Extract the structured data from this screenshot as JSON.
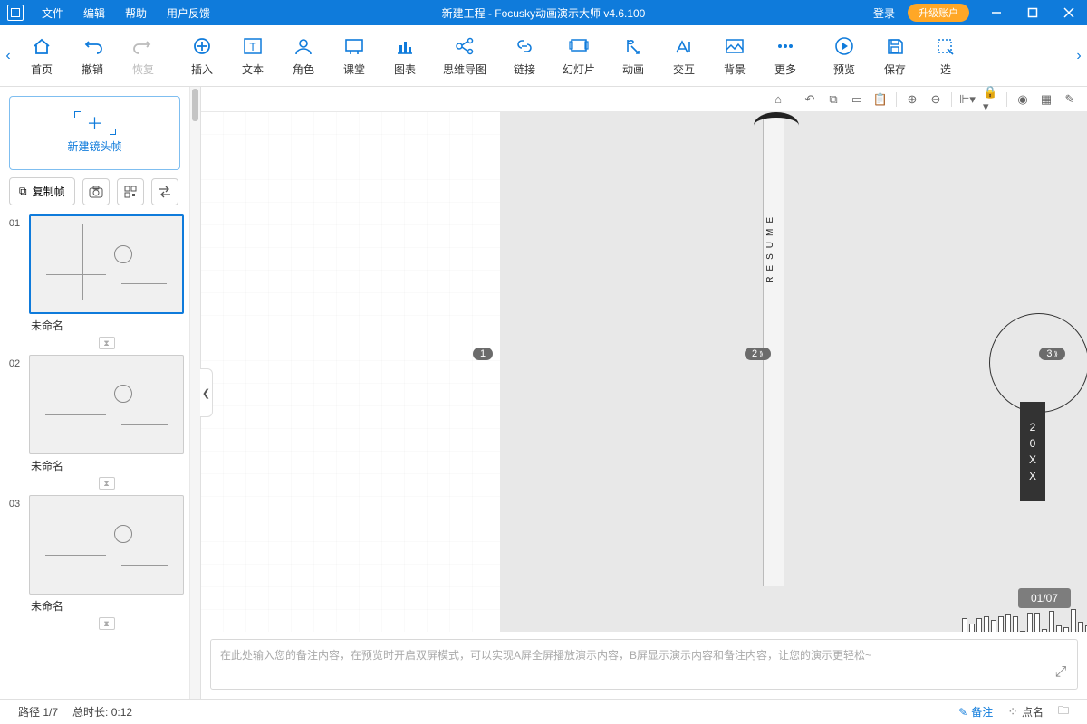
{
  "titlebar": {
    "menus": [
      "文件",
      "编辑",
      "帮助",
      "用户反馈"
    ],
    "title": "新建工程 - Focusky动画演示大师  v4.6.100",
    "login": "登录",
    "upgrade": "升级账户"
  },
  "toolbar": {
    "groups": [
      [
        {
          "id": "home",
          "label": "首页",
          "icon": "home"
        },
        {
          "id": "undo",
          "label": "撤销",
          "icon": "undo"
        },
        {
          "id": "redo",
          "label": "恢复",
          "icon": "redo",
          "disabled": true
        }
      ],
      [
        {
          "id": "insert",
          "label": "插入",
          "icon": "insert"
        },
        {
          "id": "text",
          "label": "文本",
          "icon": "text"
        },
        {
          "id": "role",
          "label": "角色",
          "icon": "role"
        },
        {
          "id": "class",
          "label": "课堂",
          "icon": "class"
        },
        {
          "id": "chart",
          "label": "图表",
          "icon": "chart"
        },
        {
          "id": "mindmap",
          "label": "思维导图",
          "icon": "mindmap"
        },
        {
          "id": "link",
          "label": "链接",
          "icon": "link"
        },
        {
          "id": "slide",
          "label": "幻灯片",
          "icon": "slide"
        },
        {
          "id": "anim",
          "label": "动画",
          "icon": "anim"
        },
        {
          "id": "interact",
          "label": "交互",
          "icon": "interact"
        },
        {
          "id": "bg",
          "label": "背景",
          "icon": "bg"
        },
        {
          "id": "more",
          "label": "更多",
          "icon": "more"
        }
      ],
      [
        {
          "id": "preview",
          "label": "预览",
          "icon": "preview"
        },
        {
          "id": "save",
          "label": "保存",
          "icon": "save"
        },
        {
          "id": "select",
          "label": "选",
          "icon": "select"
        }
      ]
    ]
  },
  "leftPanel": {
    "newFrame": "新建镜头帧",
    "copyFrame": "复制帧",
    "slides": [
      {
        "num": "01",
        "title": "未命名"
      },
      {
        "num": "02",
        "title": "未命名"
      },
      {
        "num": "03",
        "title": "未命名"
      }
    ]
  },
  "canvas": {
    "navChips": [
      "1",
      "2",
      "3"
    ],
    "pageIndicator": "01/07",
    "yearBox": [
      "2",
      "0",
      "X",
      "X"
    ],
    "resume": "RESUME"
  },
  "notes": {
    "placeholder": "在此处输入您的备注内容，在预览时开启双屏模式，可以实现A屏全屏播放演示内容，B屏显示演示内容和备注内容，让您的演示更轻松~"
  },
  "statusbar": {
    "path": "路径 1/7",
    "duration": "总时长: 0:12",
    "notes": "备注",
    "dots": "点名"
  }
}
